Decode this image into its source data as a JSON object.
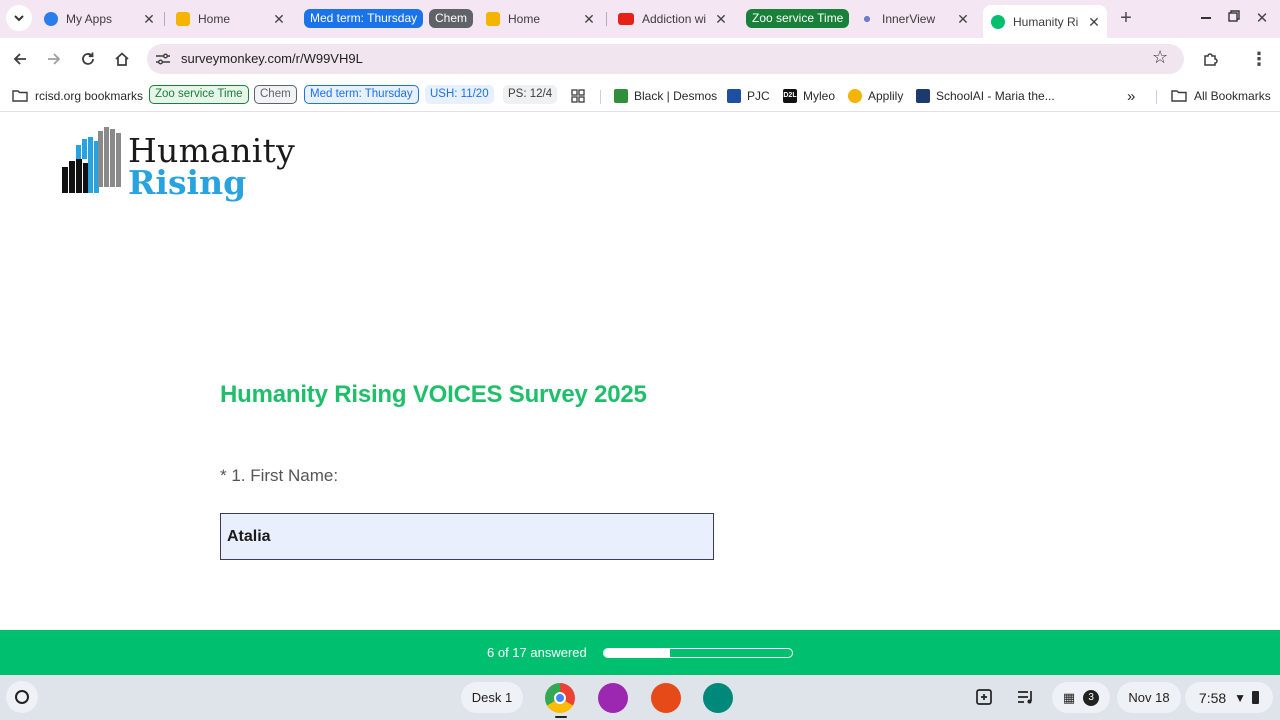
{
  "colors": {
    "tabstrip_bg": "#f4e6f3",
    "brand_green": "#00bf6f",
    "title_green": "#1fbf6a",
    "group_blue": "#1a73e8",
    "group_grey": "#5f6368",
    "group_green": "#188038"
  },
  "tabs": [
    {
      "title": "My Apps",
      "icon": "cloud-icon"
    },
    {
      "title": "Home",
      "icon": "classroom-icon"
    },
    {
      "group": "Med term: Thursday"
    },
    {
      "group": "Chem"
    },
    {
      "title": "Home",
      "icon": "classroom-icon"
    },
    {
      "title": "Addiction wi",
      "icon": "youtube-icon"
    },
    {
      "group": "Zoo service Time"
    },
    {
      "title": "InnerView",
      "icon": "innerview-icon"
    },
    {
      "title": "Humanity Ri",
      "icon": "surveymonkey-icon",
      "active": true
    }
  ],
  "toolbar": {
    "url": "surveymonkey.com/r/W99VH9L"
  },
  "bookmarks": {
    "root": "rcisd.org bookmarks",
    "chips": [
      "Zoo service Time",
      "Chem",
      "Med term: Thursday",
      "USH: 11/20",
      "PS: 12/4"
    ],
    "items": [
      "Black | Desmos",
      "PJC",
      "Myleo",
      "Applily",
      "SchoolAI - Maria the..."
    ],
    "myleo_logo": "D2L",
    "all": "All Bookmarks"
  },
  "logo": {
    "line1": "Humanity",
    "line2": "Rising"
  },
  "survey": {
    "title": "Humanity Rising VOICES Survey 2025",
    "question_label": "* 1. First Name:",
    "answer": "Atalia"
  },
  "progress": {
    "text": "6 of 17 answered",
    "answered": 6,
    "total": 17
  },
  "shelf": {
    "desk": "Desk 1",
    "notif_count": "3",
    "date": "Nov 18",
    "time": "7:58"
  }
}
